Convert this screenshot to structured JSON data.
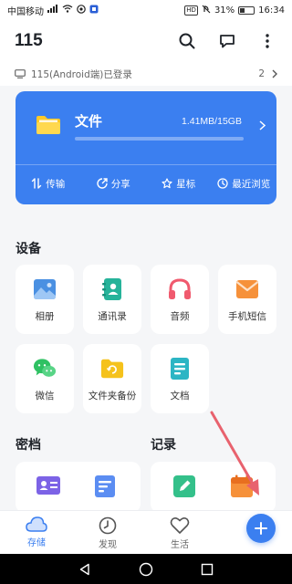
{
  "status_bar": {
    "carrier": "中国移动",
    "battery": "31%",
    "time": "16:34"
  },
  "header": {
    "title": "115"
  },
  "login": {
    "text": "115(Android端)已登录",
    "count": "2"
  },
  "storage_card": {
    "title": "文件",
    "capacity": "1.41MB/15GB",
    "usage_fraction": 0.0001,
    "quick_actions": [
      {
        "label": "传输",
        "icon": "transfer-icon"
      },
      {
        "label": "分享",
        "icon": "share-icon"
      },
      {
        "label": "星标",
        "icon": "star-icon"
      },
      {
        "label": "最近浏览",
        "icon": "recent-icon"
      }
    ]
  },
  "devices": {
    "title": "设备",
    "items": [
      {
        "label": "相册",
        "icon": "photo-album-icon",
        "color": "#4a90e2"
      },
      {
        "label": "通讯录",
        "icon": "contacts-icon",
        "color": "#26b39a"
      },
      {
        "label": "音频",
        "icon": "headphones-icon",
        "color": "#f05a6e"
      },
      {
        "label": "手机短信",
        "icon": "sms-icon",
        "color": "#f6913a"
      },
      {
        "label": "微信",
        "icon": "wechat-icon",
        "color": "#2fc163"
      },
      {
        "label": "文件夹备份",
        "icon": "folder-backup-icon",
        "color": "#f5c21b"
      },
      {
        "label": "文档",
        "icon": "document-icon",
        "color": "#2cb5c4"
      }
    ]
  },
  "secrets": {
    "title": "密档"
  },
  "records": {
    "title": "记录"
  },
  "tabs": [
    {
      "label": "存储",
      "icon": "cloud-icon",
      "active": true
    },
    {
      "label": "发现",
      "icon": "clock-icon",
      "active": false
    },
    {
      "label": "生活",
      "icon": "heart-icon",
      "active": false
    }
  ],
  "colors": {
    "accent": "#3b7ff0",
    "annotation_arrow": "#e8626e"
  }
}
